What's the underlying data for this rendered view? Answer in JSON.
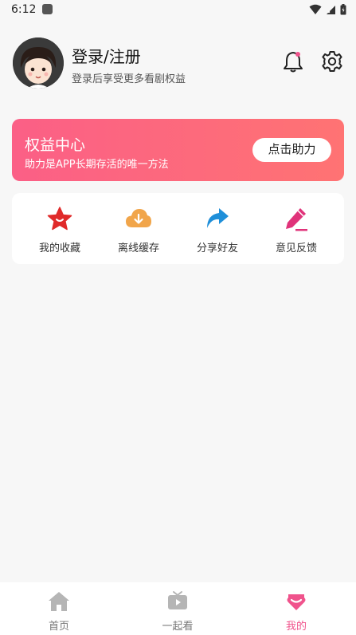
{
  "status_bar": {
    "time": "6:12"
  },
  "profile": {
    "title": "登录/注册",
    "subtitle": "登录后享受更多看剧权益"
  },
  "banner": {
    "title": "权益中心",
    "subtitle": "助力是APP长期存活的唯一方法",
    "button_label": "点击助力"
  },
  "quick_actions": [
    {
      "label": "我的收藏",
      "icon": "star-icon",
      "color": "#e02a2a"
    },
    {
      "label": "离线缓存",
      "icon": "cloud-download-icon",
      "color": "#f1a54a"
    },
    {
      "label": "分享好友",
      "icon": "share-arrow-icon",
      "color": "#1f8fd9"
    },
    {
      "label": "意见反馈",
      "icon": "pencil-icon",
      "color": "#e0337a"
    }
  ],
  "bottom_nav": [
    {
      "label": "首页",
      "icon": "home-icon",
      "active": false
    },
    {
      "label": "一起看",
      "icon": "tv-play-icon",
      "active": false
    },
    {
      "label": "我的",
      "icon": "heart-tab-icon",
      "active": true
    }
  ],
  "colors": {
    "accent": "#f0538c",
    "banner_start": "#fb5f86",
    "banner_end": "#ff7373"
  }
}
